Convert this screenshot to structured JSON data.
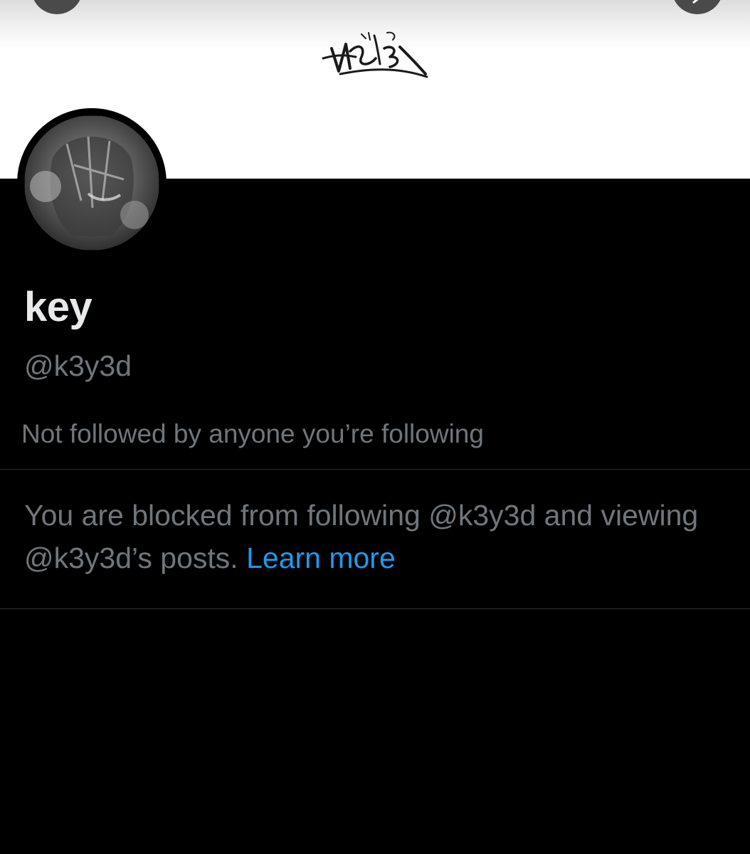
{
  "profile": {
    "display_name": "key",
    "handle": "@k3y3d",
    "followed_by": "Not followed by anyone you’re following"
  },
  "blocked": {
    "message": "You are blocked from following @k3y3d and viewing @k3y3d’s posts.",
    "learn_more": "Learn more"
  },
  "colors": {
    "background": "#000000",
    "primary_text": "#e7e9ea",
    "secondary_text": "#71767b",
    "link": "#1d9bf0",
    "divider": "#2f3336"
  }
}
